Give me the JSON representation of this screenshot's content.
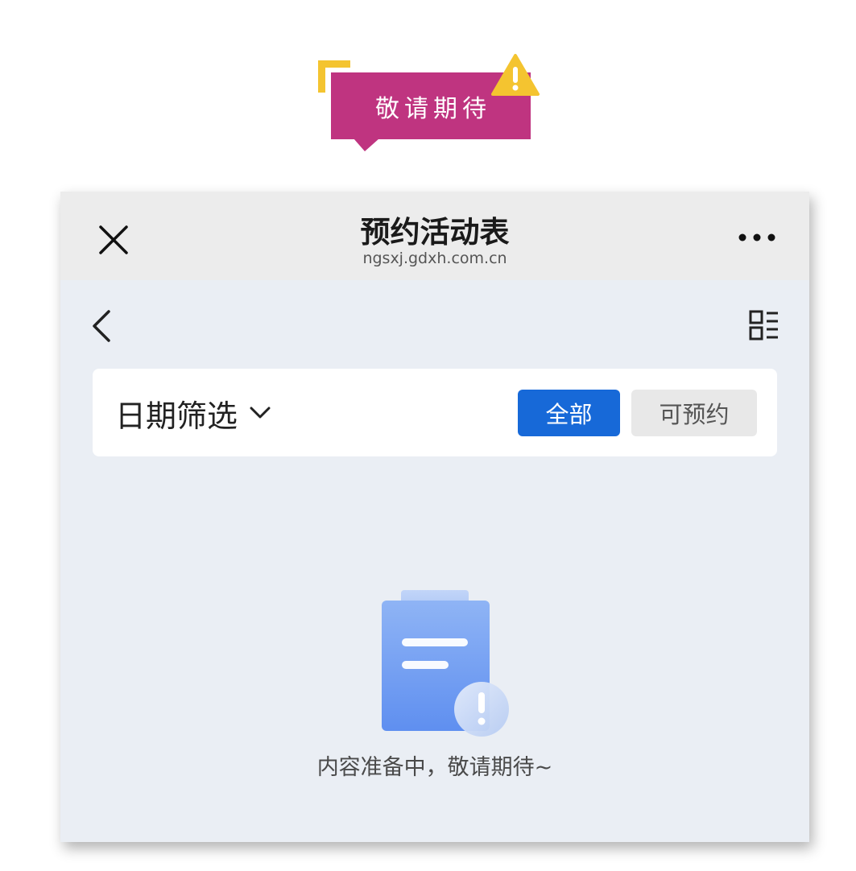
{
  "banner": {
    "text": "敬请期待",
    "warning_icon": "warning-triangle-icon",
    "colors": {
      "box": "#bf3480",
      "accent": "#f4c430"
    }
  },
  "titlebar": {
    "close_icon": "close-icon",
    "title": "预约活动表",
    "subtitle": "ngsxj.gdxh.com.cn",
    "more_icon": "more-horizontal-icon"
  },
  "nav": {
    "back_icon": "chevron-left-icon",
    "grid_icon": "grid-list-icon"
  },
  "filter": {
    "date_label": "日期筛选",
    "date_icon": "chevron-down-icon",
    "tabs": [
      {
        "label": "全部",
        "selected": true
      },
      {
        "label": "可预约",
        "selected": false
      }
    ],
    "colors": {
      "selected": "#1769d8",
      "unselected": "#e8e8e8"
    }
  },
  "empty_state": {
    "illustration": "clipboard-warning-icon",
    "message": "内容准备中，敬请期待~"
  }
}
